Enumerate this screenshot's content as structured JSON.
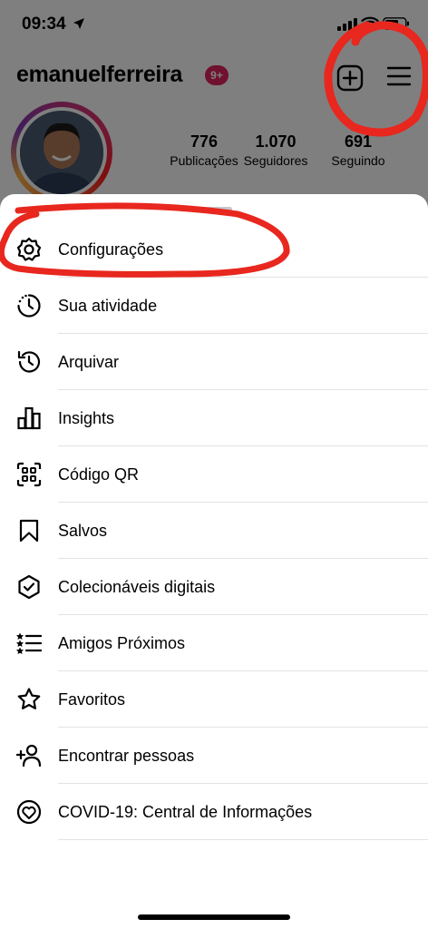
{
  "status_bar": {
    "time": "09:34"
  },
  "profile": {
    "username": "emanuelferreira",
    "notification_badge": "9+",
    "stats": [
      {
        "value": "776",
        "label": "Publicações"
      },
      {
        "value": "1.070",
        "label": "Seguidores"
      },
      {
        "value": "691",
        "label": "Seguindo"
      }
    ]
  },
  "menu": {
    "items": [
      {
        "label": "Configurações",
        "icon": "settings-gear-icon"
      },
      {
        "label": "Sua atividade",
        "icon": "activity-clock-icon"
      },
      {
        "label": "Arquivar",
        "icon": "archive-history-icon"
      },
      {
        "label": "Insights",
        "icon": "insights-bar-chart-icon"
      },
      {
        "label": "Código QR",
        "icon": "qr-code-icon"
      },
      {
        "label": "Salvos",
        "icon": "bookmark-icon"
      },
      {
        "label": "Colecionáveis digitais",
        "icon": "digital-collectibles-icon"
      },
      {
        "label": "Amigos Próximos",
        "icon": "close-friends-list-icon"
      },
      {
        "label": "Favoritos",
        "icon": "star-icon"
      },
      {
        "label": "Encontrar pessoas",
        "icon": "add-person-icon"
      },
      {
        "label": "COVID-19: Central de Informações",
        "icon": "covid-info-heart-icon"
      }
    ]
  },
  "colors": {
    "annotation_red": "#e8271e",
    "badge_red": "#e0245e"
  }
}
